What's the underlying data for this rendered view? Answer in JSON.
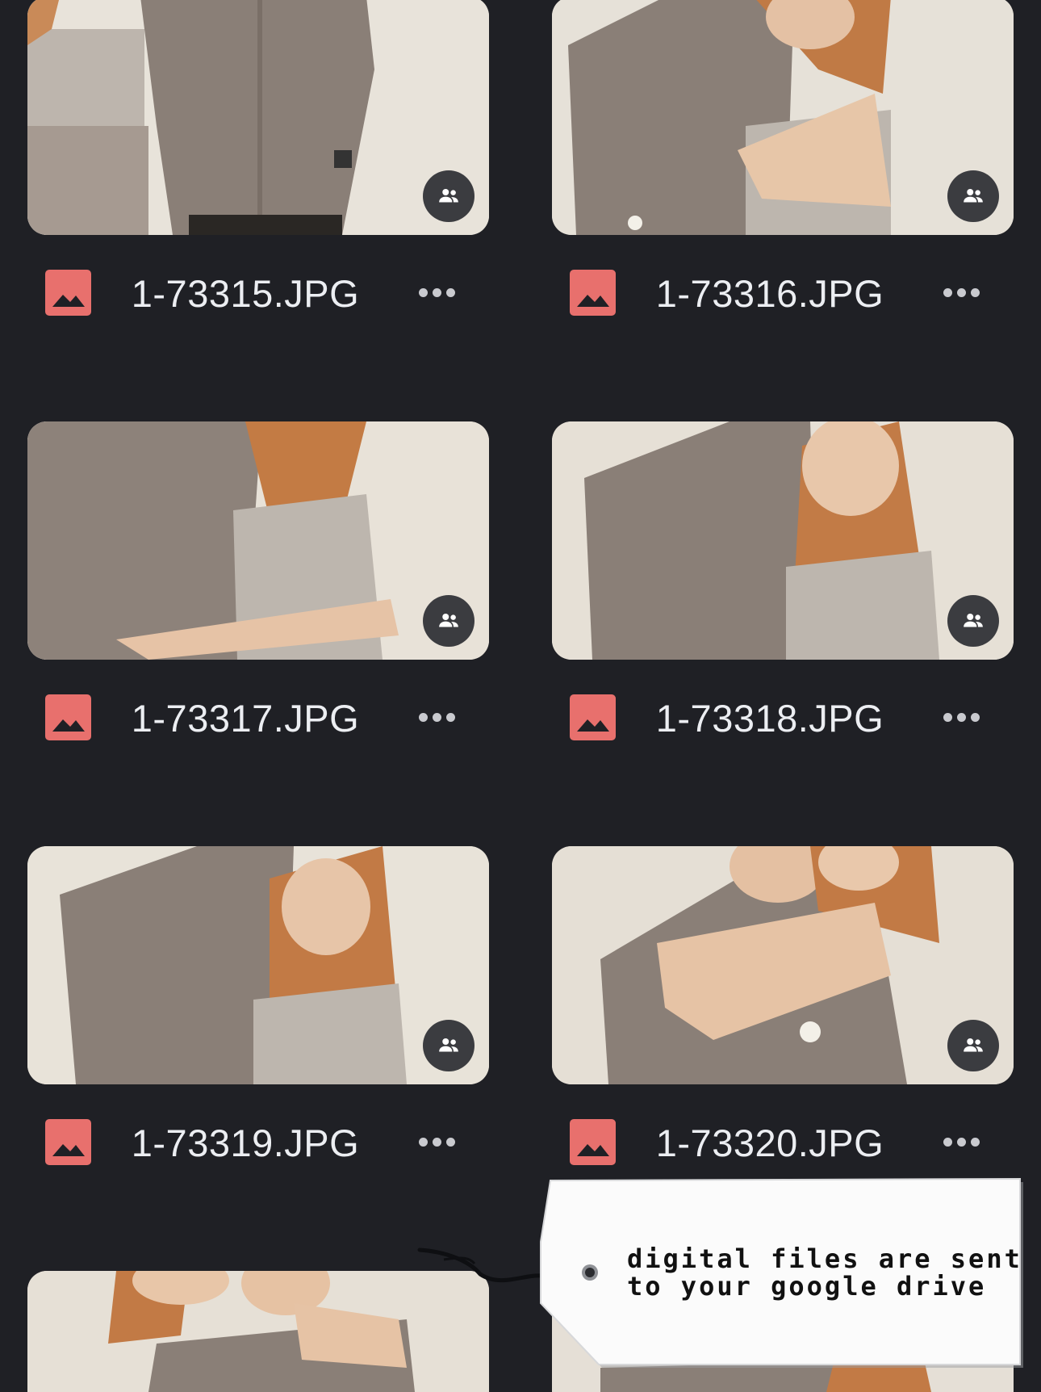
{
  "files": [
    {
      "name": "1-73315.JPG",
      "shared": true
    },
    {
      "name": "1-73316.JPG",
      "shared": true
    },
    {
      "name": "1-73317.JPG",
      "shared": true
    },
    {
      "name": "1-73318.JPG",
      "shared": true
    },
    {
      "name": "1-73319.JPG",
      "shared": true
    },
    {
      "name": "1-73320.JPG",
      "shared": true
    },
    {
      "name": "",
      "shared": false
    },
    {
      "name": "",
      "shared": false
    }
  ],
  "icons": {
    "file_type": "image-file-icon",
    "shared": "people-icon",
    "more": "more-horizontal-icon"
  },
  "colors": {
    "background": "#1f2025",
    "file_icon": "#e8706d",
    "file_name": "#eceef2",
    "badge": "#3b3c40"
  },
  "tag": {
    "line1": "digital files are sent",
    "line2": "to your google drive"
  }
}
